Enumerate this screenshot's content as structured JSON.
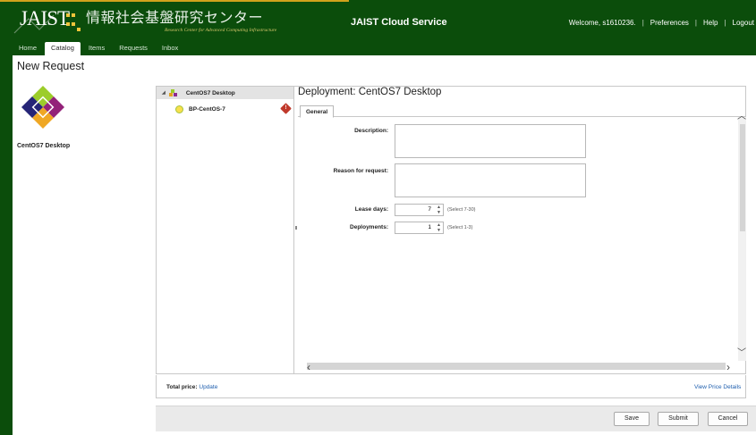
{
  "header": {
    "logo_text": "JAIST",
    "org_name": "情報社会基盤研究センター",
    "org_tagline": "Research Center for Advanced Computing Infrastructure",
    "app_title": "JAIST Cloud Service",
    "welcome": "Welcome, s1610236.",
    "links": [
      "Preferences",
      "Help",
      "Logout"
    ]
  },
  "nav": {
    "tabs": [
      {
        "label": "Home",
        "active": false
      },
      {
        "label": "Catalog",
        "active": true
      },
      {
        "label": "Items",
        "active": false
      },
      {
        "label": "Requests",
        "active": false
      },
      {
        "label": "Inbox",
        "active": false
      }
    ]
  },
  "page": {
    "title": "New Request",
    "catalog_item_name": "CentOS7 Desktop"
  },
  "tree": {
    "root": "CentOS7 Desktop",
    "child": "BP-CentOS-7",
    "child_warning_icon": "warning-icon"
  },
  "deployment": {
    "title": "Deployment: CentOS7 Desktop",
    "tab": "General",
    "fields": {
      "description_label": "Description:",
      "description_value": "",
      "reason_label": "Reason for request:",
      "reason_value": "",
      "lease_label": "Lease days:",
      "lease_value": "7",
      "lease_hint": "(Select 7-30)",
      "deployments_label": "Deployments:",
      "deployments_value": "1",
      "deployments_hint": "(Select 1-3)"
    }
  },
  "footer": {
    "total_label": "Total price:",
    "update_link": "Update",
    "view_price_details": "View Price Details"
  },
  "buttons": {
    "save": "Save",
    "submit": "Submit",
    "cancel": "Cancel"
  },
  "colors": {
    "header_bg": "#0b4d0b",
    "accent": "#d1a21c",
    "link": "#1f5fae"
  }
}
